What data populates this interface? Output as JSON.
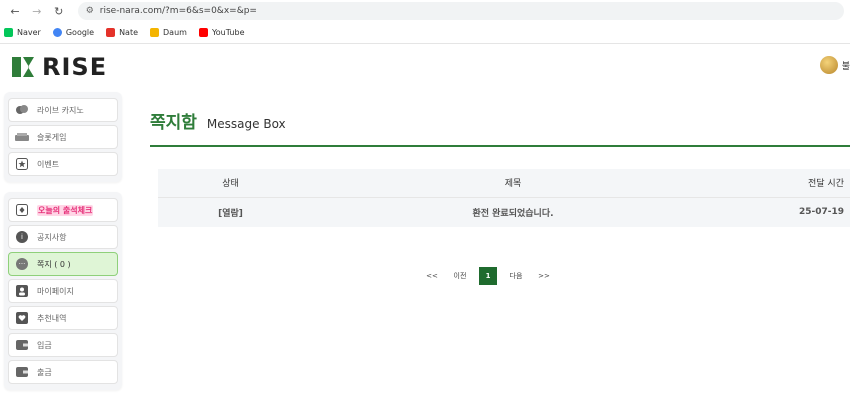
{
  "browser": {
    "url": "rise-nara.com/?m=6&s=0&x=&p=",
    "bookmarks": [
      {
        "label": "Naver",
        "color": "#03c75a"
      },
      {
        "label": "Google",
        "color": "#4285f4"
      },
      {
        "label": "Nate",
        "color": "#e4322a"
      },
      {
        "label": "Daum",
        "color": "#f4b400"
      },
      {
        "label": "YouTube",
        "color": "#ff0000"
      }
    ]
  },
  "header": {
    "logo_text": "RISE",
    "user_initial": "불",
    "accent": "#2f7d3a"
  },
  "sidebar": {
    "group1": [
      {
        "label": "라이브 카지노",
        "icon": "casino-chips-icon"
      },
      {
        "label": "슬롯게임",
        "icon": "slot-machine-icon"
      },
      {
        "label": "이벤트",
        "icon": "star-icon"
      }
    ],
    "group2": [
      {
        "label": "오늘의 출석체크",
        "icon": "attendance-card-icon"
      },
      {
        "label": "공지사항",
        "icon": "info-icon"
      },
      {
        "label": "쪽지 ( 0 )",
        "icon": "message-dots-icon"
      },
      {
        "label": "마이페이지",
        "icon": "user-icon"
      },
      {
        "label": "추천내역",
        "icon": "recommend-icon"
      },
      {
        "label": "입금",
        "icon": "wallet-in-icon"
      },
      {
        "label": "출금",
        "icon": "wallet-out-icon"
      }
    ]
  },
  "main": {
    "title_ko": "쪽지함",
    "title_en": "Message Box",
    "table": {
      "headers": [
        "상태",
        "제목",
        "전달 시간"
      ],
      "rows": [
        {
          "status": "[열람]",
          "title": "환전 완료되었습니다.",
          "date": "25-07-19"
        }
      ]
    },
    "pagination": {
      "first": "<<",
      "prev": "이전",
      "current": "1",
      "next": "다음",
      "last": ">>"
    }
  }
}
